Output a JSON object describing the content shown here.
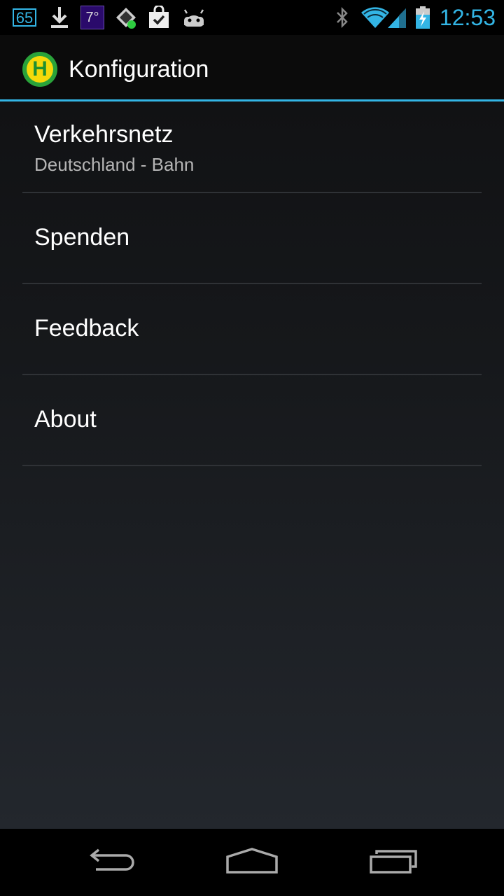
{
  "status_bar": {
    "notification_count": "65",
    "temperature": "7°",
    "time": "12:53",
    "icons": [
      "counter-badge-icon",
      "download-icon",
      "weather-icon",
      "sync-icon",
      "play-store-icon",
      "android-icon",
      "bluetooth-icon",
      "wifi-icon",
      "signal-icon",
      "battery-charging-icon"
    ]
  },
  "action_bar": {
    "logo": "bus-stop-h-icon",
    "logo_letter": "H",
    "title": "Konfiguration"
  },
  "preferences": [
    {
      "title": "Verkehrsnetz",
      "summary": "Deutschland - Bahn"
    },
    {
      "title": "Spenden"
    },
    {
      "title": "Feedback"
    },
    {
      "title": "About"
    }
  ],
  "nav_bar": {
    "buttons": [
      "back-icon",
      "home-icon",
      "recents-icon"
    ]
  },
  "colors": {
    "accent": "#33b5e5",
    "logo_green": "#2aa33a",
    "logo_yellow": "#f5d90a"
  }
}
